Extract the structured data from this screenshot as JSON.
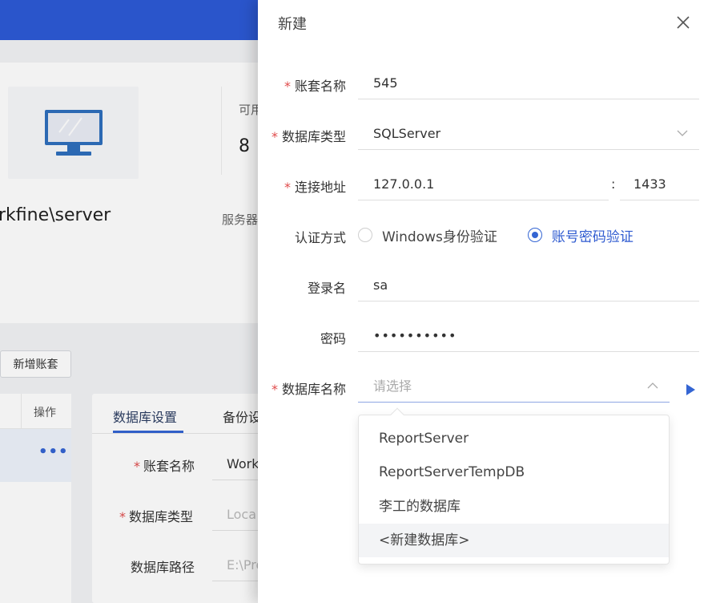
{
  "background": {
    "server_name": "rkfine\\server",
    "available_label": "可用",
    "available_value": "8",
    "server_label": "服务器",
    "add_account_button": "新增账套",
    "table": {
      "operation_header": "操作",
      "row_action": "•••"
    },
    "settings_tabs": [
      "数据库设置",
      "备份设"
    ],
    "settings_fields": [
      {
        "label": "账套名称",
        "required": true,
        "value": "Work",
        "placeholder": false
      },
      {
        "label": "数据库类型",
        "required": true,
        "value": "Loca",
        "placeholder": true
      },
      {
        "label": "数据库路径",
        "required": false,
        "value": "E:\\Pro",
        "placeholder": true
      }
    ]
  },
  "drawer": {
    "title": "新建",
    "fields": {
      "account_name": {
        "label": "账套名称",
        "required": true,
        "value": "545"
      },
      "db_type": {
        "label": "数据库类型",
        "required": true,
        "value": "SQLServer"
      },
      "address": {
        "label": "连接地址",
        "required": true,
        "host": "127.0.0.1",
        "separator": ":",
        "port": "1433"
      },
      "auth": {
        "label": "认证方式",
        "options": [
          "Windows身份验证",
          "账号密码验证"
        ],
        "selected": "账号密码验证"
      },
      "login": {
        "label": "登录名",
        "value": "sa"
      },
      "password": {
        "label": "密码",
        "value": "••••••••••"
      },
      "db_name": {
        "label": "数据库名称",
        "required": true,
        "placeholder": "请选择"
      }
    },
    "dropdown_options": [
      "ReportServer",
      "ReportServerTempDB",
      "李工的数据库",
      "<新建数据库>"
    ],
    "hovered_option": "<新建数据库>"
  },
  "colors": {
    "accent": "#3465d3",
    "required": "#e04b4b",
    "topbar": "#2d5ad6"
  }
}
